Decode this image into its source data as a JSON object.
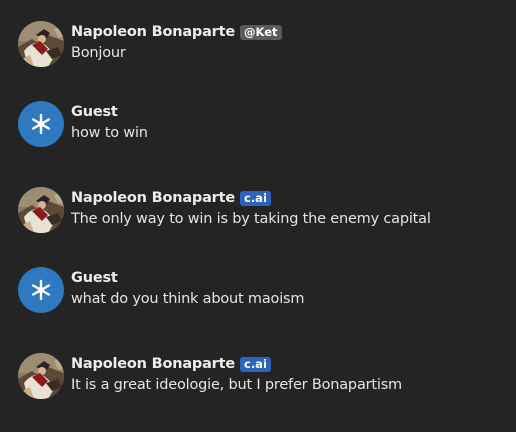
{
  "messages": [
    {
      "author": "Napoleon Bonaparte",
      "badge": "@Ket",
      "text": "Bonjour"
    },
    {
      "author": "Guest",
      "text": "how to win"
    },
    {
      "author": "Napoleon Bonaparte",
      "badge": "c.ai",
      "text": "The only way to win is by taking the enemy capital"
    },
    {
      "author": "Guest",
      "text": "what do you think about maoism"
    },
    {
      "author": "Napoleon Bonaparte",
      "badge": "c.ai",
      "text": "It is a great ideologie, but I prefer Bonapartism"
    }
  ],
  "colors": {
    "background": "#242424",
    "guest_avatar": "#2f79c0",
    "creator_badge": "#5a5a5a",
    "ai_badge": "#2e62bd"
  },
  "icons": {
    "bot_avatar": "napoleon-portrait-icon",
    "guest_avatar": "snowflake-icon"
  }
}
